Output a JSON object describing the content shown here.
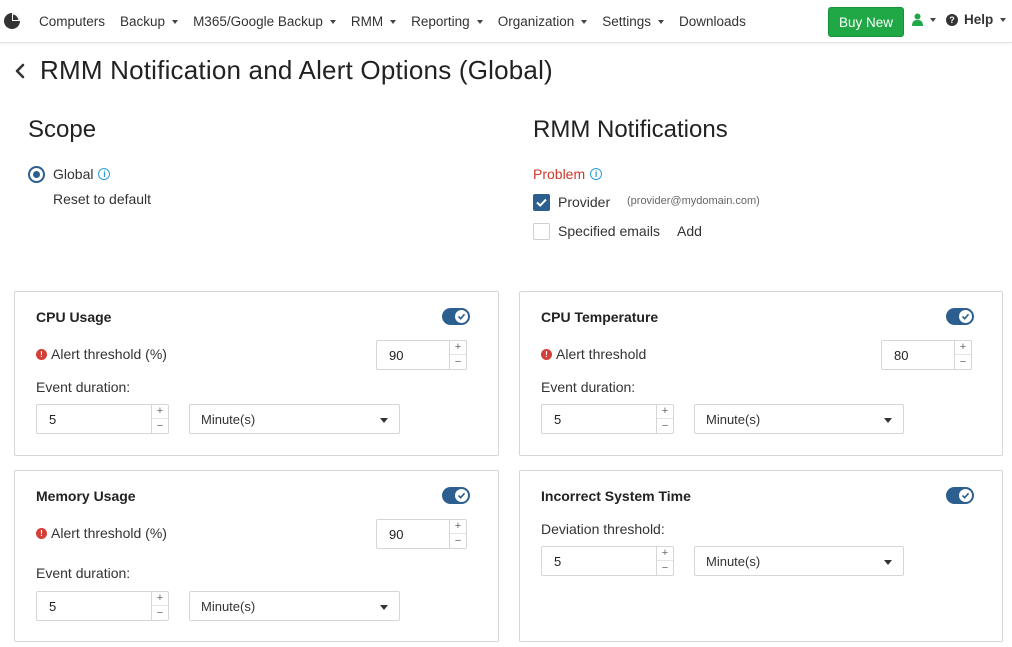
{
  "nav": {
    "items": [
      {
        "label": "Computers",
        "dropdown": false
      },
      {
        "label": "Backup",
        "dropdown": true
      },
      {
        "label": "M365/Google Backup",
        "dropdown": true
      },
      {
        "label": "RMM",
        "dropdown": true
      },
      {
        "label": "Reporting",
        "dropdown": true
      },
      {
        "label": "Organization",
        "dropdown": true
      },
      {
        "label": "Settings",
        "dropdown": true
      },
      {
        "label": "Downloads",
        "dropdown": false
      }
    ],
    "buy_label": "Buy New",
    "help_label": "Help",
    "accent_color": "#1fa845"
  },
  "page": {
    "title": "RMM Notification and Alert Options (Global)"
  },
  "scope": {
    "title": "Scope",
    "option_label": "Global",
    "reset_link": "Reset to default"
  },
  "notifications": {
    "title": "RMM Notifications",
    "problem_label": "Problem",
    "problem_color": "#d0392b",
    "provider_label": "Provider",
    "provider_email": "(provider@mydomain.com)",
    "specified_label": "Specified emails",
    "add_link": "Add"
  },
  "panels": {
    "cpu_usage": {
      "title": "CPU Usage",
      "enabled": true,
      "threshold_label": "Alert threshold (%)",
      "threshold_value": "90",
      "duration_label": "Event duration:",
      "duration_value": "5",
      "unit": "Minute(s)"
    },
    "cpu_temp": {
      "title": "CPU Temperature",
      "enabled": true,
      "threshold_label": "Alert threshold",
      "threshold_value": "80",
      "duration_label": "Event duration:",
      "duration_value": "5",
      "unit": "Minute(s)"
    },
    "memory_usage": {
      "title": "Memory Usage",
      "enabled": true,
      "threshold_label": "Alert threshold (%)",
      "threshold_value": "90",
      "duration_label": "Event duration:",
      "duration_value": "5",
      "unit": "Minute(s)"
    },
    "system_time": {
      "title": "Incorrect System Time",
      "enabled": true,
      "deviation_label": "Deviation threshold:",
      "deviation_value": "5",
      "unit": "Minute(s)"
    }
  }
}
